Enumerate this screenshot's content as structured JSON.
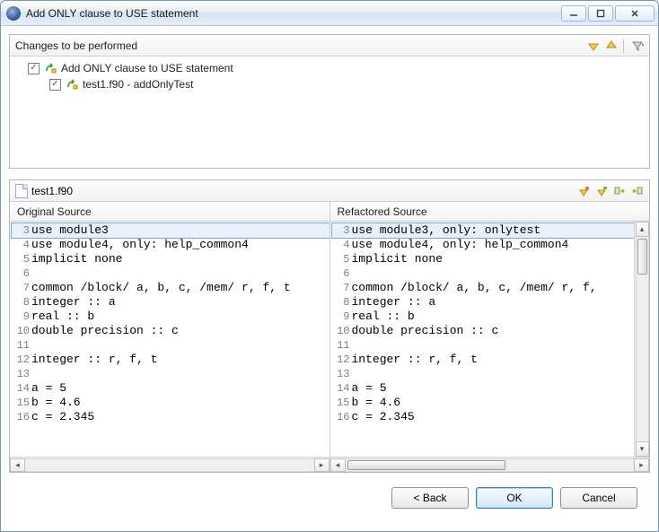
{
  "window": {
    "title": "Add ONLY clause to USE statement"
  },
  "changes_panel": {
    "title": "Changes to be performed",
    "tree": [
      {
        "indent": 0,
        "label": "Add ONLY clause to USE statement"
      },
      {
        "indent": 1,
        "label": "test1.f90 - addOnlyTest"
      }
    ]
  },
  "file_panel": {
    "filename": "test1.f90",
    "left_header": "Original Source",
    "right_header": "Refactored Source",
    "left_lines": [
      {
        "n": 3,
        "t": "use module3",
        "hl": true
      },
      {
        "n": 4,
        "t": "use module4, only: help_common4"
      },
      {
        "n": 5,
        "t": "implicit none"
      },
      {
        "n": 6,
        "t": ""
      },
      {
        "n": 7,
        "t": "common /block/ a, b, c, /mem/ r, f, t"
      },
      {
        "n": 8,
        "t": "integer :: a"
      },
      {
        "n": 9,
        "t": "real :: b"
      },
      {
        "n": 10,
        "t": "double precision :: c"
      },
      {
        "n": 11,
        "t": ""
      },
      {
        "n": 12,
        "t": "integer :: r, f, t"
      },
      {
        "n": 13,
        "t": ""
      },
      {
        "n": 14,
        "t": "a = 5"
      },
      {
        "n": 15,
        "t": "b = 4.6"
      },
      {
        "n": 16,
        "t": "c = 2.345"
      }
    ],
    "right_lines": [
      {
        "n": 3,
        "t": "use module3, only: onlytest",
        "hl": true
      },
      {
        "n": 4,
        "t": "use module4, only: help_common4"
      },
      {
        "n": 5,
        "t": "implicit none"
      },
      {
        "n": 6,
        "t": ""
      },
      {
        "n": 7,
        "t": "common /block/ a, b, c, /mem/ r, f,"
      },
      {
        "n": 8,
        "t": "integer :: a"
      },
      {
        "n": 9,
        "t": "real :: b"
      },
      {
        "n": 10,
        "t": "double precision :: c"
      },
      {
        "n": 11,
        "t": ""
      },
      {
        "n": 12,
        "t": "integer :: r, f, t"
      },
      {
        "n": 13,
        "t": ""
      },
      {
        "n": 14,
        "t": "a = 5"
      },
      {
        "n": 15,
        "t": "b = 4.6"
      },
      {
        "n": 16,
        "t": "c = 2.345"
      }
    ]
  },
  "buttons": {
    "back": "< Back",
    "ok": "OK",
    "cancel": "Cancel"
  }
}
